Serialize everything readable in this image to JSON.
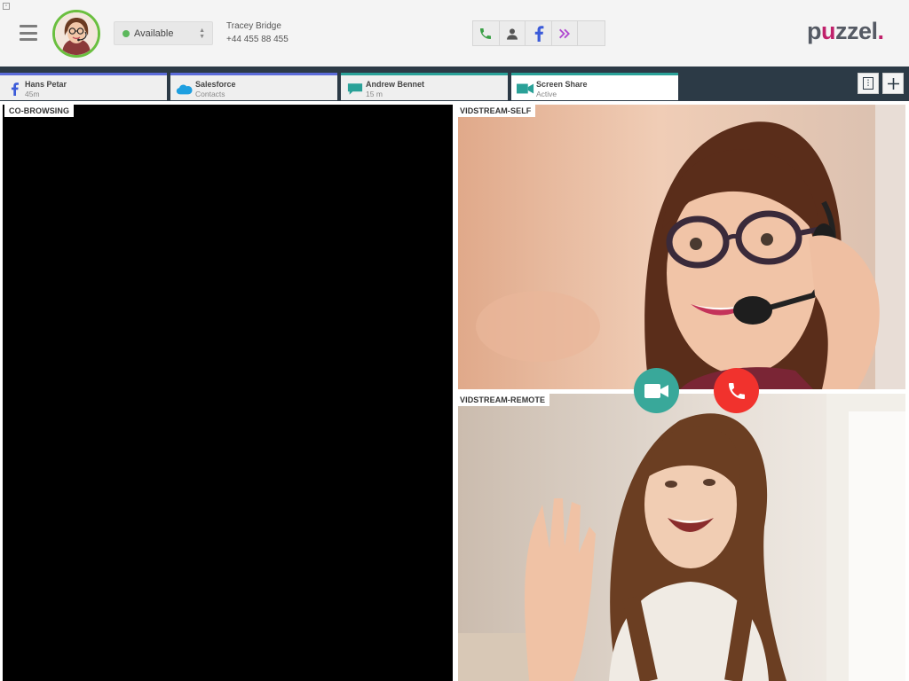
{
  "header": {
    "agent": {
      "name": "Tracey Bridge",
      "phone": "+44 455 88 455"
    },
    "status": {
      "label": "Available",
      "color": "#5cb85c"
    },
    "toolbar": [
      {
        "icon": "phone-icon",
        "color": "#3aa046"
      },
      {
        "icon": "user-icon",
        "color": "#555555"
      },
      {
        "icon": "facebook-icon",
        "color": "#3b5bd9"
      },
      {
        "icon": "double-chevron-icon",
        "color": "#b04ad0"
      },
      {
        "icon": "empty",
        "color": ""
      }
    ],
    "logo": {
      "pre": "p",
      "mid": "u",
      "post": "zzel",
      "dot": "."
    }
  },
  "tabs": [
    {
      "title": "Hans Petar",
      "sub": "45m",
      "icon": "facebook-icon"
    },
    {
      "title": "Salesforce",
      "sub": "Contacts",
      "icon": "salesforce-cloud-icon"
    },
    {
      "title": "Andrew Bennet",
      "sub": "15 m",
      "icon": "chat-bubble-icon"
    },
    {
      "title": "Screen Share",
      "sub": "Active",
      "icon": "video-camera-icon",
      "active": true
    }
  ],
  "panes": {
    "cobrowse_label": "CO-BROWSING",
    "self_label": "VIDSTREAM-SELF",
    "remote_label": "VIDSTREAM-REMOTE"
  },
  "colors": {
    "accent": "#2aa198",
    "brand": "#c0216b",
    "tabbar": "#2c3a46",
    "hangup": "#f1322d",
    "video": "#39a89a"
  }
}
